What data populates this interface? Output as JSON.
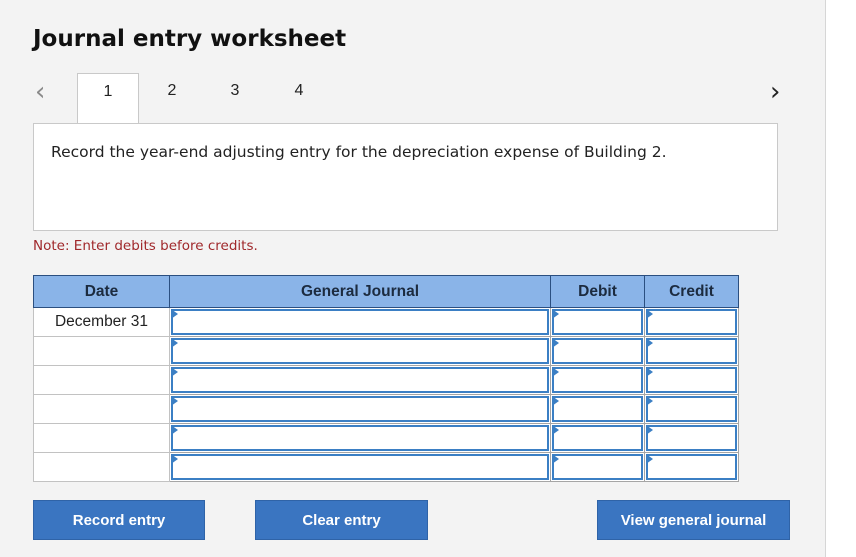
{
  "worksheet": {
    "title": "Journal entry worksheet",
    "tabs": [
      {
        "label": "1"
      },
      {
        "label": "2"
      },
      {
        "label": "3"
      },
      {
        "label": "4"
      }
    ],
    "prev_icon": "chevron-left-icon",
    "next_icon": "chevron-right-icon",
    "question": "Record the year-end adjusting entry for the depreciation expense of Building 2.",
    "note": "Note: Enter debits before credits."
  },
  "table": {
    "headers": {
      "date": "Date",
      "general_journal": "General Journal",
      "debit": "Debit",
      "credit": "Credit"
    },
    "rows": [
      {
        "date": "December 31",
        "account": "",
        "debit": "",
        "credit": ""
      },
      {
        "date": "",
        "account": "",
        "debit": "",
        "credit": ""
      },
      {
        "date": "",
        "account": "",
        "debit": "",
        "credit": ""
      },
      {
        "date": "",
        "account": "",
        "debit": "",
        "credit": ""
      },
      {
        "date": "",
        "account": "",
        "debit": "",
        "credit": ""
      },
      {
        "date": "",
        "account": "",
        "debit": "",
        "credit": ""
      }
    ]
  },
  "buttons": {
    "record": "Record entry",
    "clear": "Clear entry",
    "view": "View general journal"
  },
  "colors": {
    "header_bg": "#8ab4e8",
    "field_border": "#3b7fc4",
    "button_bg": "#3a75c1",
    "note_text": "#a0282b"
  }
}
